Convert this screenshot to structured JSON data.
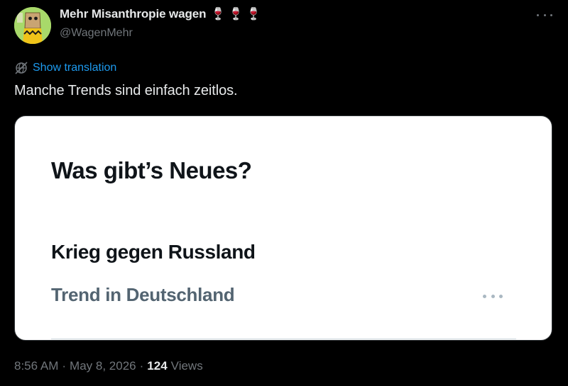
{
  "author": {
    "display_name": "Mehr Misanthropie wagen",
    "name_emojis": "🍷🍷🍷",
    "handle": "@WagenMehr",
    "avatar_icon": "charlie-brown-paper-bag-avatar"
  },
  "actions": {
    "more_icon": "more-horizontal-icon"
  },
  "translation": {
    "icon": "globe-slash-icon",
    "label": "Show translation"
  },
  "tweet": {
    "text": "Manche Trends sind einfach zeitlos."
  },
  "card": {
    "headline": "Was gibt’s Neues?",
    "trend_title": "Krieg gegen Russland",
    "trend_subtitle": "Trend in Deutschland",
    "more_icon": "more-horizontal-icon"
  },
  "meta": {
    "time": "8:56 AM",
    "separator1": "·",
    "date": "May 8, 2026",
    "separator2": "·",
    "view_count": "124",
    "views_label": "Views"
  },
  "colors": {
    "background": "#000000",
    "text_primary": "#e7e9ea",
    "text_secondary": "#71767b",
    "link": "#1d9bf0",
    "card_bg": "#ffffff",
    "card_text": "#0f1419",
    "card_subtext": "#536471"
  }
}
